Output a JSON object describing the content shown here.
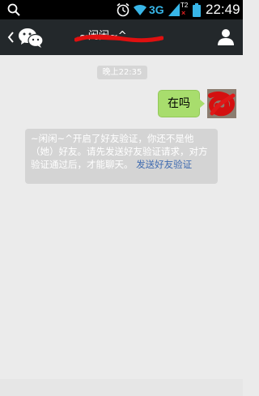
{
  "status_bar": {
    "network_type": "3G",
    "sim_label": "T2",
    "sim_mark": "×",
    "time": "22:49",
    "icons": [
      "search-icon",
      "alarm-icon",
      "wifi-icon",
      "signal-icon",
      "battery-icon"
    ]
  },
  "header": {
    "title": "~闲闲~^",
    "icons": [
      "chevron-left-icon",
      "wechat-logo-icon",
      "person-icon"
    ],
    "background_color": "#23282b"
  },
  "conversation": {
    "timestamp": "晚上22:35",
    "messages": [
      {
        "direction": "outgoing",
        "text": "在吗"
      }
    ],
    "system_notice": {
      "text": "~闲闲~^开启了好友验证，你还不是他（她）好友。请先发送好友验证请求，对方验证通过后，才能聊天。",
      "link_text": "发送好友验证"
    }
  },
  "colors": {
    "outgoing_bubble": "#a8dd6d",
    "link": "#3f6bb0",
    "redaction": "#e01010"
  }
}
